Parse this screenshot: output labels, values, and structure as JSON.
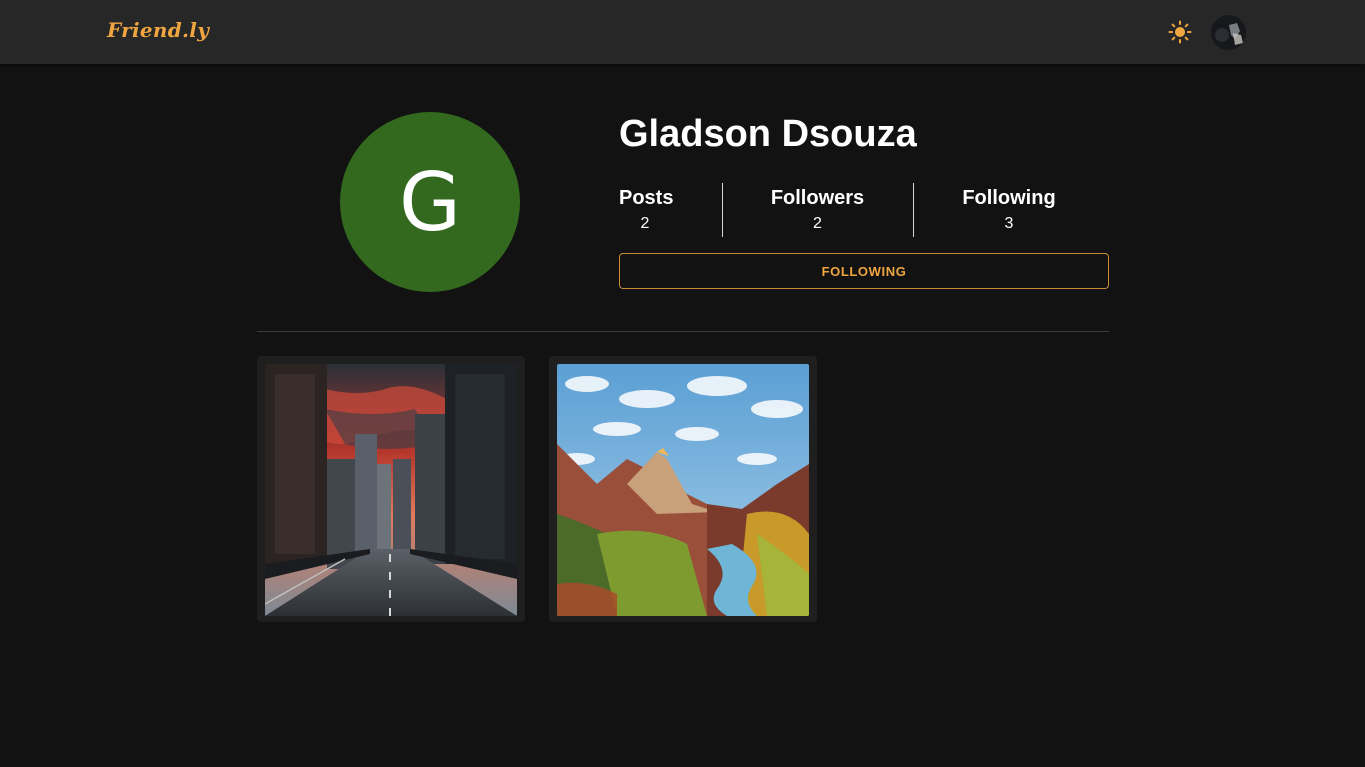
{
  "app": {
    "logo": "Friend.ly",
    "theme_icon": "sun-icon",
    "avatar_icon": "user-avatar-icon"
  },
  "colors": {
    "accent": "#f0a640",
    "avatar_bg": "#33691e",
    "page_bg": "#121212",
    "appbar_bg": "#272727"
  },
  "profile": {
    "initial": "G",
    "name": "Gladson Dsouza",
    "stats": [
      {
        "label": "Posts",
        "value": "2"
      },
      {
        "label": "Followers",
        "value": "2"
      },
      {
        "label": "Following",
        "value": "3"
      }
    ],
    "follow_button": "FOLLOWING"
  },
  "posts": [
    {
      "subject": "city-street-sunset-image"
    },
    {
      "subject": "mountain-canyon-river-image"
    }
  ]
}
